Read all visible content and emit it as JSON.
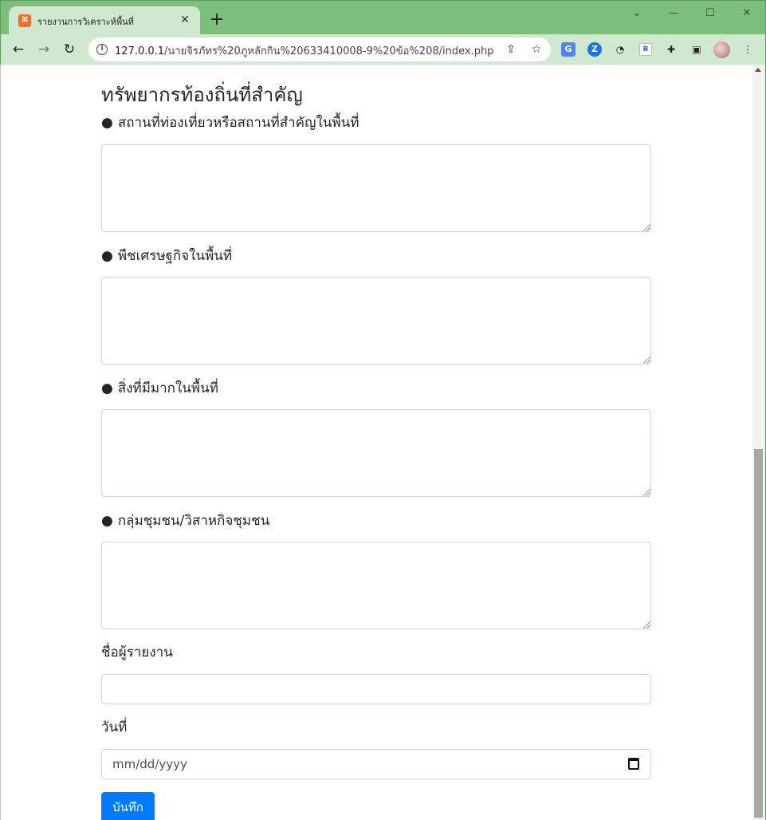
{
  "browser": {
    "tab_title": "รายงานการวิเคราะห์พื้นที่",
    "favicon_name": "xampp-icon",
    "tab_close": "✕",
    "new_tab": "+",
    "url_host": "127.0.0.1",
    "url_path": "/นายจิรภัทร%20ภูหลักกิน%20633410008-9%20ข้อ%208/index.php",
    "window_controls": {
      "chevron": "⌄",
      "minimize": "—",
      "maximize": "☐",
      "close": "✕"
    },
    "nav": {
      "back": "←",
      "forward": "→",
      "reload": "↻"
    },
    "toolbar_icons": [
      "share-icon",
      "bookmark-star-icon",
      "google-translate-icon",
      "zotero-icon",
      "speed-icon",
      "bootstrap-ext-icon",
      "extensions-puzzle-icon",
      "side-panel-icon",
      "profile-avatar",
      "menu-kebab-icon"
    ]
  },
  "form": {
    "section_title": "ทรัพยากรท้องถิ่นที่สำคัญ",
    "bullet": "●",
    "fields": [
      {
        "label": "สถานที่ท่องเที่ยวหรือสถานที่สำคัญในพื้นที่",
        "value": ""
      },
      {
        "label": "พืชเศรษฐกิจในพื้นที่",
        "value": ""
      },
      {
        "label": "สิ่งที่มีมากในพื้นที่",
        "value": ""
      },
      {
        "label": "กลุ่มชุมชน/วิสาหกิจชุมชน",
        "value": ""
      }
    ],
    "reporter_label": "ชื่อผู้รายงาน",
    "reporter_value": "",
    "date_label": "วันที่",
    "date_placeholder": "mm/dd/yyyy",
    "submit_label": "บันทึก"
  },
  "colors": {
    "tabbar": "#7cbf7c",
    "toolbar": "#cfe8cf",
    "primary_button": "#007bff",
    "input_border": "#ced4da"
  }
}
